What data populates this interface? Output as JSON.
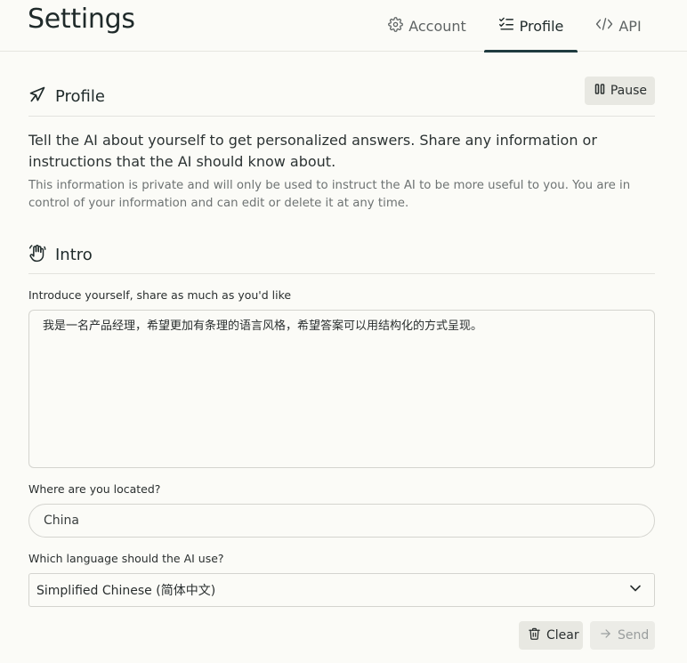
{
  "header": {
    "title": "Settings",
    "tabs": [
      {
        "label": "Account",
        "icon": "gear-icon"
      },
      {
        "label": "Profile",
        "icon": "checklist-icon",
        "active": true
      },
      {
        "label": "API",
        "icon": "code-icon"
      }
    ]
  },
  "profile_section": {
    "title": "Profile",
    "icon": "send-arrow-icon",
    "pause_label": "Pause"
  },
  "description": "Tell the AI about yourself to get personalized answers. Share any information or instructions that the AI should know about.",
  "privacy_note": "This information is private and will only be used to instruct the AI to be more useful to you. You are in control of your information and can edit or delete it at any time.",
  "intro_section": {
    "title": "Intro",
    "icon": "waving-hand-icon"
  },
  "fields": {
    "intro_label": "Introduce yourself, share as much as you'd like",
    "intro_value": "我是一名产品经理，希望更加有条理的语言风格，希望答案可以用结构化的方式呈现。",
    "location_label": "Where are you located?",
    "location_value": "China",
    "language_label": "Which language should the AI use?",
    "language_value": "Simplified Chinese (简体中文)"
  },
  "actions": {
    "clear_label": "Clear",
    "send_label": "Send"
  },
  "colors": {
    "background": "#fbfbf7",
    "accent": "#1f3b3f",
    "button_bg": "#e8e8e2"
  }
}
